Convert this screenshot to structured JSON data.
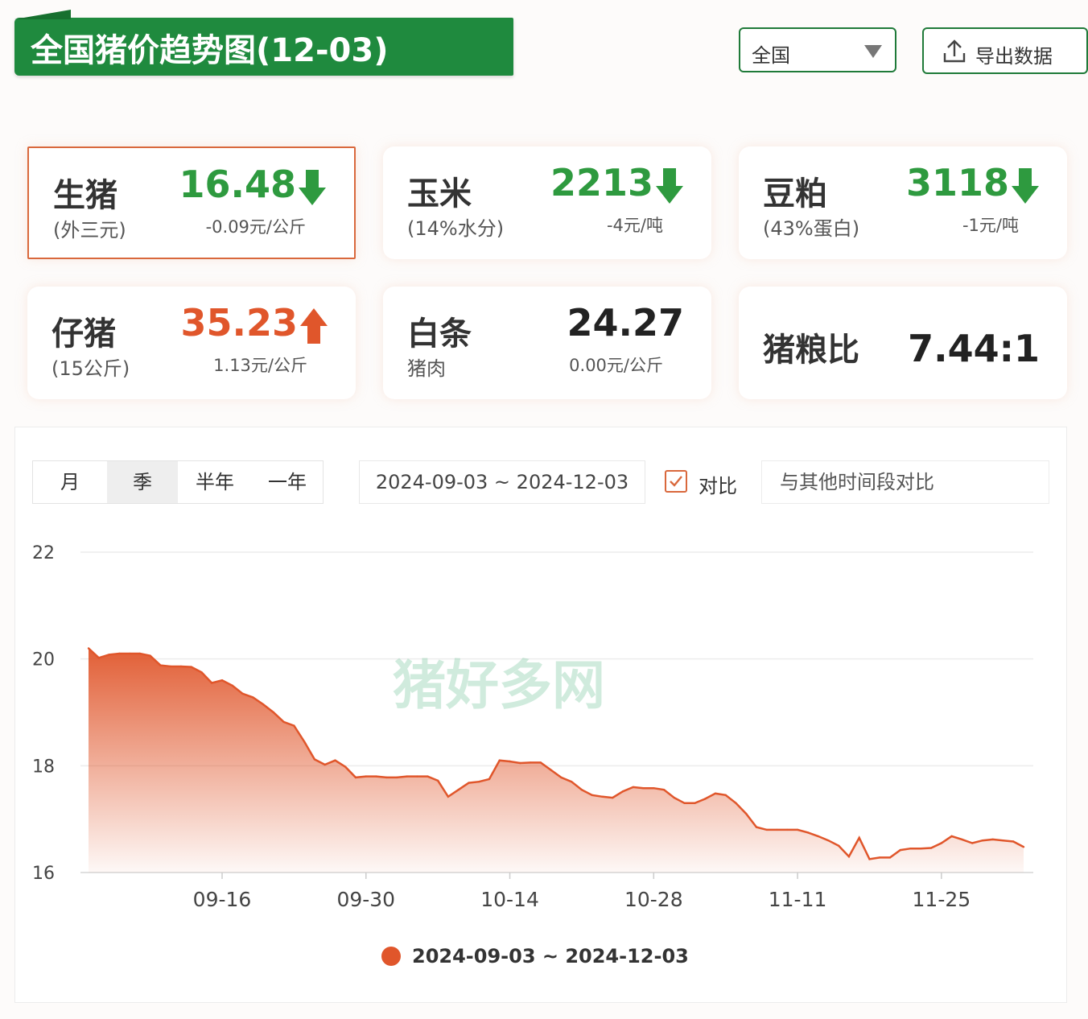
{
  "header": {
    "title": "全国猪价趋势图(12-03)",
    "region": "全国",
    "export_label": "导出数据"
  },
  "cards": [
    {
      "name": "生猪",
      "sub": "(外三元)",
      "price": "16.48",
      "change": "-0.09元/公斤",
      "trend": "down",
      "color": "#2e9a3f"
    },
    {
      "name": "玉米",
      "sub": "(14%水分)",
      "price": "2213",
      "change": "-4元/吨",
      "trend": "down",
      "color": "#2e9a3f"
    },
    {
      "name": "豆粕",
      "sub": "(43%蛋白)",
      "price": "3118",
      "change": "-1元/吨",
      "trend": "down",
      "color": "#2e9a3f"
    },
    {
      "name": "仔猪",
      "sub": "(15公斤)",
      "price": "35.23",
      "change": "1.13元/公斤",
      "trend": "up",
      "color": "#e0562b"
    },
    {
      "name": "白条",
      "sub": "猪肉",
      "price": "24.27",
      "change": "0.00元/公斤",
      "trend": "flat",
      "color": "#222222"
    },
    {
      "name": "猪粮比",
      "sub": "",
      "price": "7.44:1",
      "change": "",
      "trend": "flat",
      "color": "#222222"
    }
  ],
  "controls": {
    "tabs": [
      "月",
      "季",
      "半年",
      "一年"
    ],
    "selected_tab": "季",
    "date_range": "2024-09-03 ~ 2024-12-03",
    "compare_label": "对比",
    "compare_checked": true,
    "compare_placeholder": "与其他时间段对比"
  },
  "watermark": "猪好多网",
  "chart_data": {
    "type": "area",
    "x_start": "2024-09-03",
    "x_end": "2024-12-03",
    "x_ticks": [
      "09-16",
      "09-30",
      "10-14",
      "10-28",
      "11-11",
      "11-25"
    ],
    "y_ticks": [
      16,
      18,
      20,
      22
    ],
    "ylim": [
      16,
      22
    ],
    "grid": true,
    "color": "#e0562b",
    "legend": "2024-09-03 ~ 2024-12-03",
    "legend_position": "bottom",
    "series": [
      {
        "x": [
          "09-03",
          "09-04",
          "09-05",
          "09-06",
          "09-07",
          "09-08",
          "09-09",
          "09-10",
          "09-11",
          "09-12",
          "09-13",
          "09-14",
          "09-15",
          "09-16",
          "09-17",
          "09-18",
          "09-19",
          "09-20",
          "09-21",
          "09-22",
          "09-23",
          "09-24",
          "09-25",
          "09-26",
          "09-27",
          "09-28",
          "09-29",
          "09-30",
          "10-01",
          "10-02",
          "10-03",
          "10-04",
          "10-05",
          "10-06",
          "10-07",
          "10-08",
          "10-09",
          "10-10",
          "10-11",
          "10-12",
          "10-13",
          "10-14",
          "10-15",
          "10-16",
          "10-17",
          "10-18",
          "10-19",
          "10-20",
          "10-21",
          "10-22",
          "10-23",
          "10-24",
          "10-25",
          "10-26",
          "10-27",
          "10-28",
          "10-29",
          "10-30",
          "10-31",
          "11-01",
          "11-02",
          "11-03",
          "11-04",
          "11-05",
          "11-06",
          "11-07",
          "11-08",
          "11-09",
          "11-10",
          "11-11",
          "11-12",
          "11-13",
          "11-14",
          "11-15",
          "11-16",
          "11-17",
          "11-18",
          "11-19",
          "11-20",
          "11-21",
          "11-22",
          "11-23",
          "11-24",
          "11-25",
          "11-26",
          "11-27",
          "11-28",
          "11-29",
          "11-30",
          "12-01",
          "12-02",
          "12-03"
        ],
        "values": [
          20.2,
          20.02,
          20.08,
          20.1,
          20.1,
          20.1,
          20.06,
          19.88,
          19.86,
          19.86,
          19.85,
          19.75,
          19.55,
          19.6,
          19.5,
          19.35,
          19.28,
          19.15,
          19.0,
          18.82,
          18.75,
          18.45,
          18.12,
          18.02,
          18.1,
          17.98,
          17.78,
          17.8,
          17.8,
          17.78,
          17.78,
          17.8,
          17.8,
          17.8,
          17.72,
          17.42,
          17.55,
          17.68,
          17.7,
          17.75,
          18.1,
          18.08,
          18.05,
          18.06,
          18.06,
          17.92,
          17.78,
          17.7,
          17.55,
          17.45,
          17.42,
          17.4,
          17.52,
          17.6,
          17.58,
          17.58,
          17.55,
          17.4,
          17.3,
          17.3,
          17.38,
          17.48,
          17.45,
          17.3,
          17.1,
          16.85,
          16.8,
          16.8,
          16.8,
          16.8,
          16.75,
          16.68,
          16.6,
          16.5,
          16.3,
          16.65,
          16.25,
          16.28,
          16.28,
          16.42,
          16.45,
          16.45,
          16.46,
          16.55,
          16.68,
          16.62,
          16.55,
          16.6,
          16.62,
          16.6,
          16.58,
          16.48
        ]
      }
    ]
  }
}
